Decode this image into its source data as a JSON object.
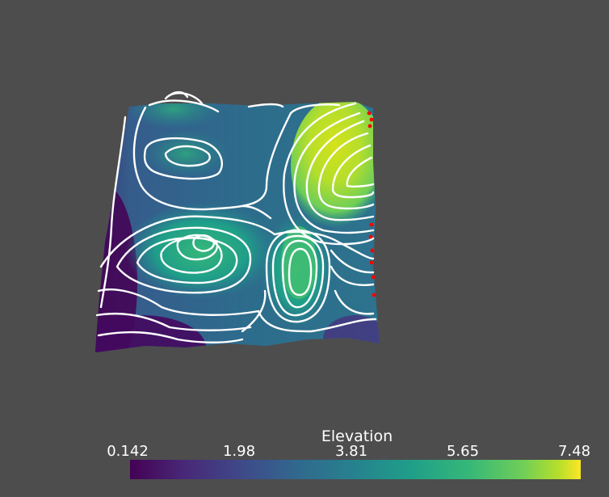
{
  "scalar_bar": {
    "title": "Elevation",
    "ticks": [
      "0.142",
      "1.98",
      "3.81",
      "5.65",
      "7.48"
    ],
    "range": [
      0.142,
      7.48
    ],
    "colormap": "viridis",
    "colors": {
      "min": "#440154",
      "mid": "#26828e",
      "max": "#fde725"
    }
  },
  "scene": {
    "background": "#4d4d4d",
    "contour_color": "#ffffff",
    "marker_color": "#ff0000"
  }
}
